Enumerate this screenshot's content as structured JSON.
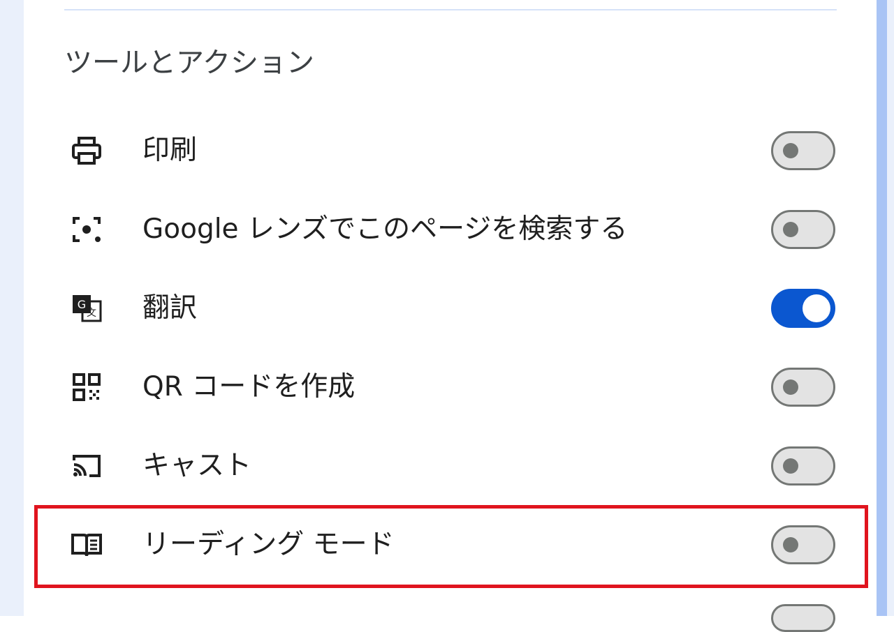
{
  "section": {
    "title": "ツールとアクション"
  },
  "items": [
    {
      "label": "印刷",
      "icon": "printer-icon",
      "enabled": false
    },
    {
      "label": "Google レンズでこのページを検索する",
      "icon": "google-lens-icon",
      "enabled": false
    },
    {
      "label": "翻訳",
      "icon": "translate-icon",
      "enabled": true
    },
    {
      "label": "QR コードを作成",
      "icon": "qr-code-icon",
      "enabled": false
    },
    {
      "label": "キャスト",
      "icon": "cast-icon",
      "enabled": false
    },
    {
      "label": "リーディング モード",
      "icon": "reading-mode-icon",
      "enabled": false
    }
  ],
  "colors": {
    "toggle_on": "#0b57d0",
    "toggle_off": "#e3e3e3",
    "highlight": "#e0141e",
    "accent_bar": "#a9c4f5"
  }
}
